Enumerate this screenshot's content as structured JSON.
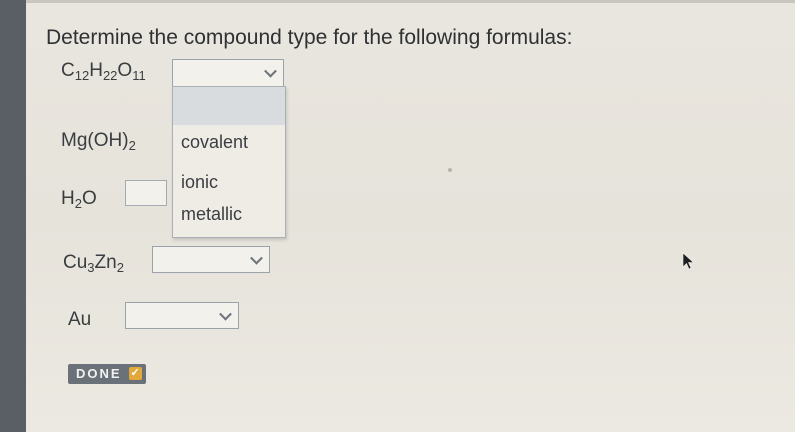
{
  "question": "Determine the compound type for the following formulas:",
  "formulas": [
    {
      "parts": [
        [
          "C",
          "12"
        ],
        [
          "H",
          "22"
        ],
        [
          "O",
          "11"
        ]
      ]
    },
    {
      "parts": [
        [
          "Mg(OH)",
          "2"
        ]
      ]
    },
    {
      "parts": [
        [
          "H",
          "2"
        ],
        [
          "O",
          ""
        ]
      ]
    },
    {
      "parts": [
        [
          "Cu",
          "3"
        ],
        [
          "Zn",
          "2"
        ]
      ]
    },
    {
      "parts": [
        [
          "Au",
          ""
        ]
      ]
    }
  ],
  "dropdown_options": [
    "",
    "covalent",
    "ionic",
    "metallic"
  ],
  "selected_values": [
    "",
    "",
    "",
    "",
    ""
  ],
  "done_label": "DONE",
  "done_check": "✓"
}
